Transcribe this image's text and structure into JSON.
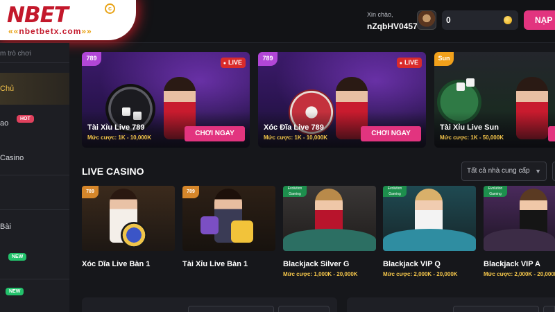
{
  "header": {
    "logo_text": "NBET",
    "logo_sub": "nbetbetx.com",
    "logo_reg": "c",
    "greeting": "Xin chào,",
    "username": "nZqbHV0457",
    "balance": "0",
    "deposit_label": "NẠP"
  },
  "sidebar": {
    "search_placeholder": "m trò chơi",
    "items": [
      {
        "label": "Chủ",
        "active": true
      },
      {
        "label": "ao",
        "badge": "HOT"
      },
      {
        "label": "Casino"
      },
      {
        "label": ""
      },
      {
        "label": "Bài"
      },
      {
        "label": "",
        "badge": "NEW"
      },
      {
        "label": "",
        "badge": "NEW"
      }
    ]
  },
  "featured": [
    {
      "brand": "789",
      "live": "LIVE",
      "title": "Tài Xỉu Live 789",
      "bet": "Mức cược: 1K - 10,000K",
      "cta": "CHƠI NGAY"
    },
    {
      "brand": "789",
      "live": "LIVE",
      "title": "Xóc Đĩa Live 789",
      "bet": "Mức cược: 1K - 10,000K",
      "cta": "CHƠI NGAY"
    },
    {
      "brand": "Sun",
      "title": "Tài Xỉu Live Sun",
      "bet": "Mức cược: 1K - 50,000K"
    }
  ],
  "live_casino": {
    "title": "LIVE CASINO",
    "provider_select": "Tất cả nhà cung cấp",
    "games": [
      {
        "name": "Xóc Dĩa Live Bàn 1",
        "bet": ""
      },
      {
        "name": "Tài Xỉu Live Bàn 1",
        "bet": ""
      },
      {
        "name": "Blackjack Silver G",
        "bet": "Mức cược: 1,000K - 20,000K"
      },
      {
        "name": "Blackjack VIP Q",
        "bet": "Mức cược: 2,000K - 20,000K"
      },
      {
        "name": "Blackjack VIP A",
        "bet": "Mức cược: 2,000K - 20,000K"
      }
    ]
  },
  "colors": {
    "accent_pink": "#e2347f",
    "bet_gold": "#f3c54a",
    "live_red": "#d92b2b",
    "brand_red": "#c3182b"
  },
  "icons": [
    "coin-icon",
    "chevron-down-icon",
    "live-dot-icon"
  ]
}
